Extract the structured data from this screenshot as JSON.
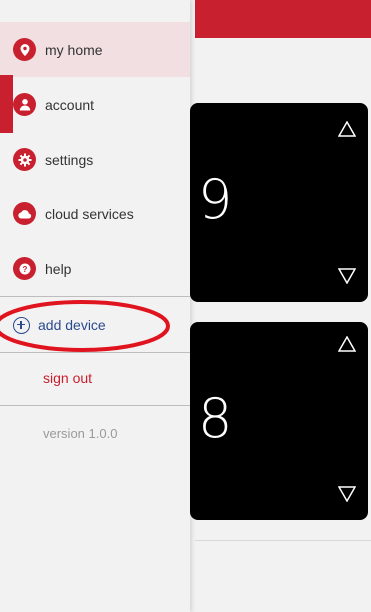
{
  "drawer": {
    "items": [
      {
        "label": "my home",
        "icon": "location-pin-icon",
        "active": true
      },
      {
        "label": "account",
        "icon": "person-icon",
        "active": false
      },
      {
        "label": "settings",
        "icon": "gear-icon",
        "active": false
      },
      {
        "label": "cloud services",
        "icon": "cloud-icon",
        "active": false
      },
      {
        "label": "help",
        "icon": "question-icon",
        "active": false
      }
    ],
    "add_device": "add device",
    "sign_out": "sign out",
    "version": "version 1.0.0"
  },
  "thermostats": [
    {
      "temp_digit": "9"
    },
    {
      "temp_digit": "8"
    }
  ],
  "colors": {
    "accent": "#c8202f",
    "link": "#2a4a8e",
    "active_bg": "#f1dfe1"
  }
}
